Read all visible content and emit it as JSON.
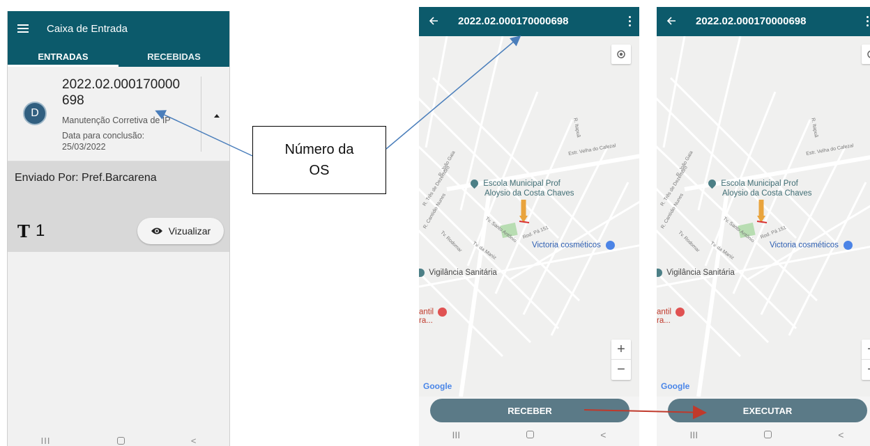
{
  "inbox": {
    "title": "Caixa de Entrada",
    "tabs": [
      {
        "label": "ENTRADAS",
        "active": true
      },
      {
        "label": "RECEBIDAS",
        "active": false
      }
    ],
    "item": {
      "avatar_letter": "D",
      "number": "2022.02.000170000698",
      "description": "Manutenção Corretiva de IP",
      "due_label": "Data para conclusão:",
      "due_date": "25/03/2022"
    },
    "sender": "Enviado Por: Pref.Barcarena",
    "attachment_count": "1",
    "view_button": "Vizualizar"
  },
  "callout": {
    "line1": "Número da",
    "line2": "OS"
  },
  "map_screen": {
    "title": "2022.02.000170000698",
    "poi_school_line1": "Escola Municipal Prof",
    "poi_school_line2": "Aloysio da Costa Chaves",
    "poi_store": "Victoria cosméticos",
    "poi_health": "Vigilância Sanitária",
    "poi_hospital_1": "antil",
    "poi_hospital_2": "ra...",
    "streets": {
      "s1": "R. João Gaia",
      "s2": "R. Três de Dezembro",
      "s3": "R. Cantídio Nunes",
      "s4": "Tv. Santo Antônio",
      "s5": "Tv. Rodomar",
      "s6": "Tv. da Maniz",
      "s7": "Rod. Pá 151",
      "s8": "Estr. Velha do Cafezal",
      "s9": "R. Itapuã"
    },
    "google": "Google",
    "zoom_in": "+",
    "zoom_out": "−"
  },
  "buttons": {
    "receive": "RECEBER",
    "execute": "EXECUTAR"
  },
  "nav": {
    "recents": "III",
    "back": "<"
  },
  "colors": {
    "app_bar": "#0c5a6b",
    "action_button": "#5b7a87",
    "arrow_blue": "#4a7ebb",
    "arrow_red": "#c0392b"
  }
}
